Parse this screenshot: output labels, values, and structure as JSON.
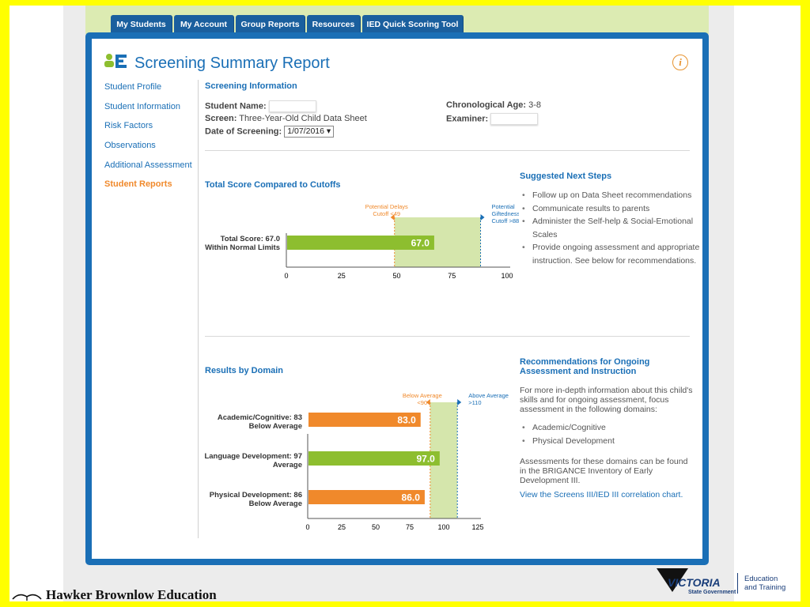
{
  "nav": {
    "tabs": [
      "My Students",
      "My Account",
      "Group Reports",
      "Resources",
      "IED Quick Scoring Tool"
    ]
  },
  "page_title": "Screening Summary Report",
  "info_icon_glyph": "i",
  "sidebar": {
    "items": [
      {
        "label": "Student Profile"
      },
      {
        "label": "Student Information"
      },
      {
        "label": "Risk Factors"
      },
      {
        "label": "Observations"
      },
      {
        "label": "Additional Assessment"
      },
      {
        "label": "Student Reports"
      }
    ],
    "active_index": 5
  },
  "screening_info": {
    "heading": "Screening Information",
    "student_name_label": "Student Name:",
    "screen_label": "Screen:",
    "screen_value": "Three-Year-Old Child Data Sheet",
    "date_label": "Date of Screening:",
    "date_value": "1/07/2016",
    "age_label": "Chronological Age:",
    "age_value": "3-8",
    "examiner_label": "Examiner:"
  },
  "total_score": {
    "heading": "Total Score Compared to Cutoffs",
    "score_label_line1": "Total Score: 67.0",
    "score_label_line2": "Within Normal Limits"
  },
  "next_steps": {
    "heading": "Suggested Next Steps",
    "items": [
      "Follow up on Data Sheet recommendations",
      "Communicate results to parents",
      "Administer the Self-help & Social-Emotional Scales",
      "Provide ongoing assessment and appropriate instruction. See below for recommendations."
    ]
  },
  "results_domain": {
    "heading": "Results by Domain"
  },
  "recommendations": {
    "heading": "Recommendations for Ongoing Assessment and Instruction",
    "intro": "For more in-depth information about this child's skills and for ongoing assessment, focus assessment in the following domains:",
    "domains": [
      "Academic/Cognitive",
      "Physical Development"
    ],
    "note": "Assessments for these domains can be found in the BRIGANCE Inventory of Early Development III.",
    "link_text": "View the Screens III/IED III correlation chart."
  },
  "footer": {
    "publisher": "Hawker Brownlow Education",
    "gov_name": "VICTORIA",
    "gov_sub": "State Government",
    "dept_line1": "Education",
    "dept_line2": "and Training"
  },
  "colors": {
    "brand_blue": "#1a6fb6",
    "nav_tab": "#1a5f9e",
    "green_bar": "#8dbe2f",
    "orange_bar": "#f0892b",
    "band": "#d5e6ac",
    "active_link": "#f0892b",
    "frame_yellow": "#ffff00"
  },
  "chart_data": [
    {
      "type": "bar",
      "orientation": "horizontal",
      "categories": [
        "Total Score: 67.0 Within Normal Limits"
      ],
      "values": [
        67.0
      ],
      "value_labels": [
        "67.0"
      ],
      "xlim": [
        0,
        100
      ],
      "xticks": [
        0,
        25,
        50,
        75,
        100
      ],
      "band": [
        49,
        88
      ],
      "cutoffs": [
        {
          "value": 49,
          "label_lines": [
            "Potential Delays",
            "Cutoff <49"
          ],
          "color": "#f0892b"
        },
        {
          "value": 88,
          "label_lines": [
            "Potential",
            "Giftedness",
            "Cutoff >88"
          ],
          "color": "#1a6fb6"
        }
      ],
      "bar_colors": [
        "#8dbe2f"
      ]
    },
    {
      "type": "bar",
      "orientation": "horizontal",
      "categories": [
        "Academic/Cognitive: 83",
        "Language Development: 97",
        "Physical Development: 86"
      ],
      "category_sublabels": [
        "Below Average",
        "Average",
        "Below Average"
      ],
      "values": [
        83.0,
        97.0,
        86.0
      ],
      "value_labels": [
        "83.0",
        "97.0",
        "86.0"
      ],
      "xlim": [
        0,
        125
      ],
      "xticks": [
        0,
        25,
        50,
        75,
        100,
        125
      ],
      "band": [
        90,
        110
      ],
      "cutoffs": [
        {
          "value": 90,
          "label_lines": [
            "Below Average",
            "<90"
          ],
          "color": "#f0892b"
        },
        {
          "value": 110,
          "label_lines": [
            "Above Average",
            ">110"
          ],
          "color": "#1a6fb6"
        }
      ],
      "bar_colors": [
        "#f0892b",
        "#8dbe2f",
        "#f0892b"
      ]
    }
  ]
}
